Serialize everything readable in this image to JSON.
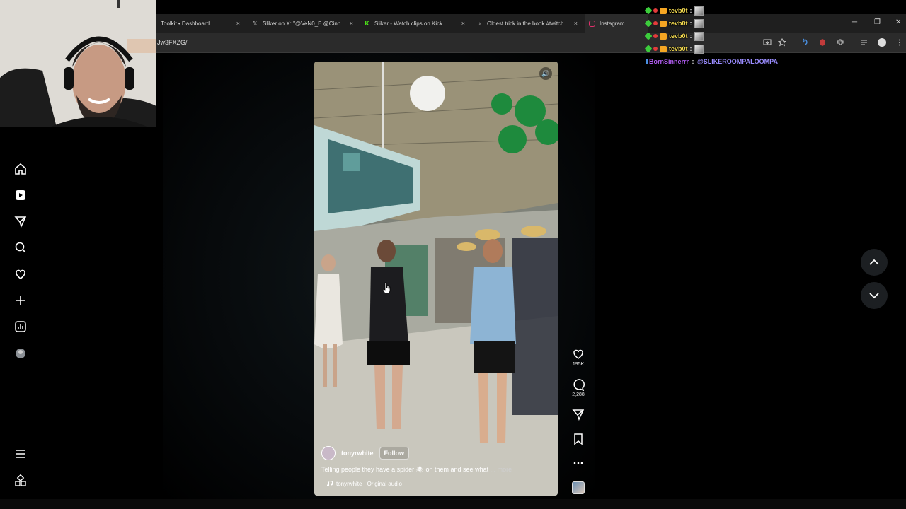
{
  "browser": {
    "tabs": [
      {
        "label": "Toolkit • Dashboard",
        "close": "×",
        "icon": "generic"
      },
      {
        "label": "Sliker on X: \"@VeN0_E @Cinnal",
        "close": "×",
        "icon": "x-logo"
      },
      {
        "label": "Sliker - Watch clips on Kick",
        "close": "×",
        "icon": "kick-logo"
      },
      {
        "label": "Oldest trick in the book #twitch",
        "close": "×",
        "icon": "tiktok-logo"
      },
      {
        "label": "Instagram",
        "close": "",
        "icon": "instagram-logo"
      }
    ],
    "url_fragment": "Jw3FXZG/",
    "window_controls": {
      "minimize": "─",
      "restore": "❐",
      "close": "✕"
    }
  },
  "reel": {
    "author": "tonyrwhite",
    "follow_label": "Follow",
    "caption": "Telling people they have a spider 🕷 on them and see what",
    "caption_more": "... more",
    "audio": "tonyrwhite · Original audio",
    "mute_glyph": "🔊"
  },
  "actions": {
    "likes": "195K",
    "comments": "2,288"
  },
  "chat": {
    "lines": [
      {
        "user": "tevb0t",
        "sep": " :",
        "color": "#f2d94e"
      },
      {
        "user": "tevb0t",
        "sep": " :",
        "color": "#f2d94e"
      },
      {
        "user": "tevb0t",
        "sep": " :",
        "color": "#f2d94e"
      },
      {
        "user": "tevb0t",
        "sep": " :",
        "color": "#f2d94e"
      }
    ],
    "message": {
      "user": "BornSinnerrr",
      "sep": " : ",
      "text": "@SLIKEROOMPALOOMPA",
      "color": "#b05cf0"
    }
  },
  "colors": {
    "accent": "#0095f6",
    "chat_mention": "#9a8cff"
  }
}
